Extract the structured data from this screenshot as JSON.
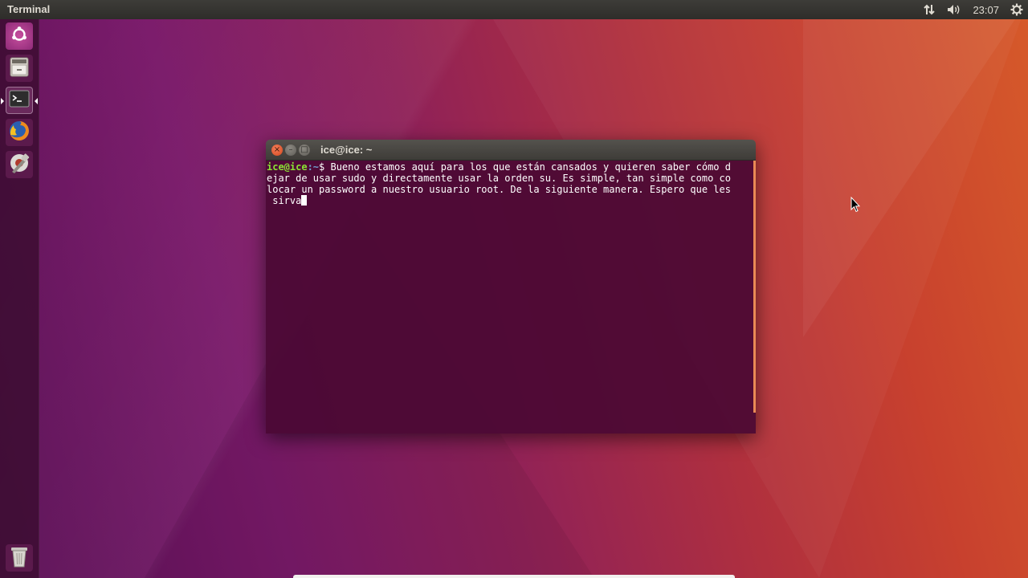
{
  "top_panel": {
    "app_title": "Terminal",
    "clock": "23:07",
    "indicators": [
      "network-icon",
      "volume-icon",
      "gear-icon"
    ]
  },
  "launcher": {
    "items": [
      {
        "name": "ubuntu-dash",
        "icon": "ubuntu-logo-icon"
      },
      {
        "name": "files",
        "icon": "file-cabinet-icon"
      },
      {
        "name": "terminal",
        "icon": "terminal-icon",
        "active": true
      },
      {
        "name": "firefox",
        "icon": "firefox-icon"
      },
      {
        "name": "system-settings",
        "icon": "settings-icon"
      },
      {
        "name": "trash",
        "icon": "trash-icon"
      }
    ]
  },
  "terminal": {
    "title": "ice@ice: ~",
    "prompt_user": "ice@ice",
    "prompt_path": ":~",
    "prompt_symbol": "$ ",
    "lines": [
      "Bueno estamos aquí para los que están cansados y quieren saber cómo d",
      "ejar de usar sudo y directamente usar la orden su. Es simple, tan simple como co",
      "locar un password a nuestro usuario root. De la siguiente manera. Espero que les",
      " sirva"
    ]
  },
  "colors": {
    "prompt_user": "#8ae234",
    "prompt_path": "#729fcf",
    "terminal_bg": "#4a0934",
    "scrollbar": "#e98a55",
    "close_button": "#e95420"
  }
}
